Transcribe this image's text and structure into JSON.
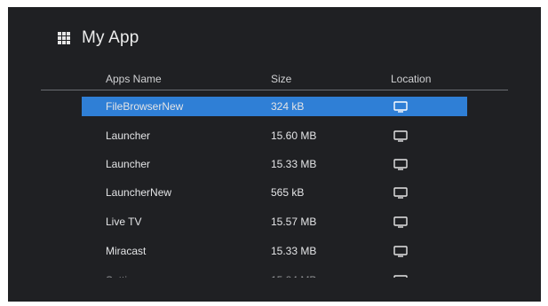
{
  "header": {
    "title": "My App",
    "icon": "apps-grid-icon"
  },
  "columns": {
    "name": "Apps Name",
    "size": "Size",
    "location": "Location"
  },
  "rows": [
    {
      "name": "FileBrowserNew",
      "size": "324 kB",
      "location_icon": "tv-icon",
      "selected": true
    },
    {
      "name": "Launcher",
      "size": "15.60 MB",
      "location_icon": "tv-icon",
      "selected": false
    },
    {
      "name": "Launcher",
      "size": "15.33 MB",
      "location_icon": "tv-icon",
      "selected": false
    },
    {
      "name": "LauncherNew",
      "size": "565 kB",
      "location_icon": "tv-icon",
      "selected": false
    },
    {
      "name": "Live TV",
      "size": "15.57 MB",
      "location_icon": "tv-icon",
      "selected": false
    },
    {
      "name": "Miracast",
      "size": "15.33 MB",
      "location_icon": "tv-icon",
      "selected": false
    }
  ],
  "colors": {
    "background": "#1f2023",
    "selection": "#2f7fd6",
    "text": "#e3e4e6",
    "divider": "#6b6d72"
  }
}
